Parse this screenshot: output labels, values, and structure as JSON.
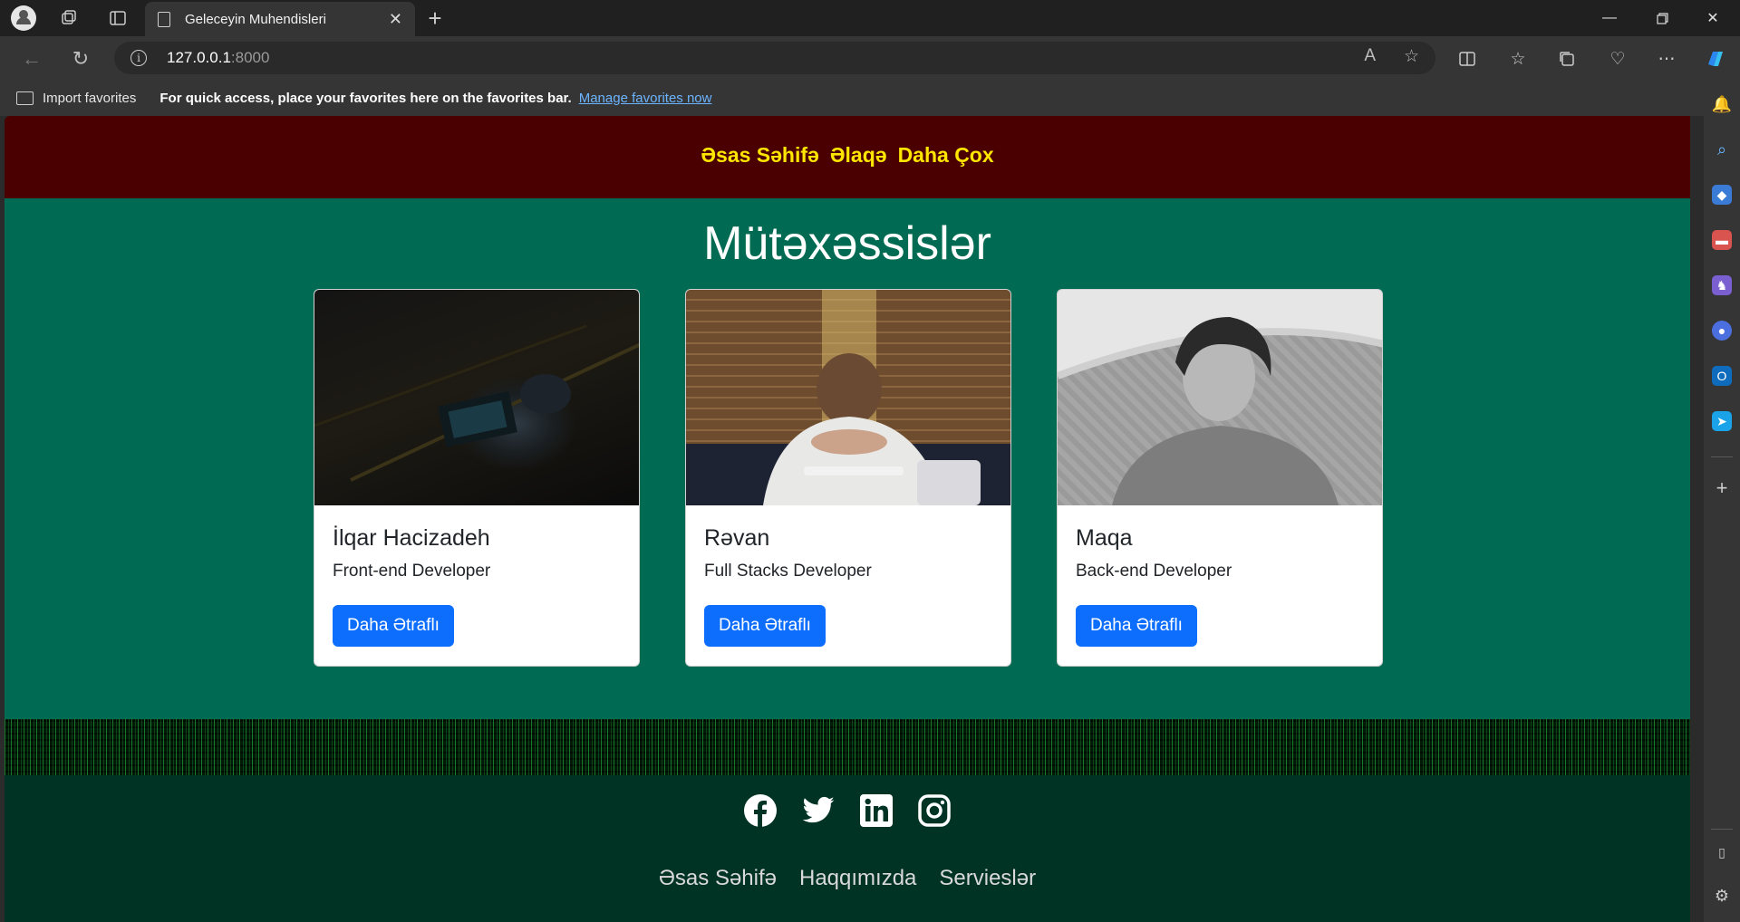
{
  "browser": {
    "tab_title": "Geleceyin Muhendisleri",
    "url_host": "127.0.0.1",
    "url_port": ":8000",
    "favorites": {
      "import_label": "Import favorites",
      "message": "For quick access, place your favorites here on the favorites bar.",
      "manage_link": "Manage favorites now"
    }
  },
  "page": {
    "nav": [
      "Əsas Səhifə",
      "Əlaqə",
      "Daha Çox"
    ],
    "heading": "Mütəxəssislər",
    "cards": [
      {
        "name": "İlqar Hacizadeh",
        "role": "Front-end Developer",
        "button": "Daha Ətraflı"
      },
      {
        "name": "Rəvan",
        "role": "Full Stacks Developer",
        "button": "Daha Ətraflı"
      },
      {
        "name": "Maqa",
        "role": "Back-end Developer",
        "button": "Daha Ətraflı"
      }
    ],
    "footer_links": [
      "Əsas Səhifə",
      "Haqqımızda",
      "Servieslər"
    ]
  },
  "colors": {
    "nav_bg": "#4a0000",
    "nav_text": "#ffe600",
    "section_bg": "#006b52",
    "footer_bg": "#003324",
    "button": "#0d6efd"
  },
  "icons": {
    "social": [
      "facebook-icon",
      "twitter-icon",
      "linkedin-icon",
      "instagram-icon"
    ]
  }
}
